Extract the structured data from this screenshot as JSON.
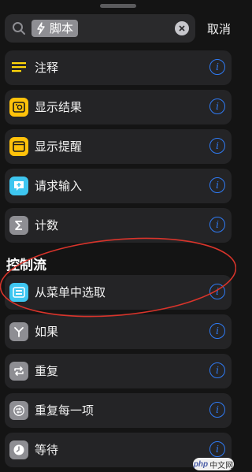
{
  "search": {
    "token_label": "脚本",
    "cancel_label": "取消"
  },
  "colors": {
    "background": "#141414",
    "row_bg": "#242426",
    "info_blue": "#2f7bf5",
    "annotation_red": "#d9342b"
  },
  "rows_top": [
    {
      "label": "注释",
      "icon": "comment-lines-icon",
      "icon_bg": "#242426",
      "icon_color": "#ffd60a"
    },
    {
      "label": "显示结果",
      "icon": "quick-look-icon",
      "icon_bg": "#ffc20a",
      "icon_color": "#1a1a1a"
    },
    {
      "label": "显示提醒",
      "icon": "alert-window-icon",
      "icon_bg": "#ffc20a",
      "icon_color": "#1a1a1a"
    },
    {
      "label": "请求输入",
      "icon": "ask-input-icon",
      "icon_bg": "#3ec6f0",
      "icon_color": "#ffffff"
    },
    {
      "label": "计数",
      "icon": "sigma-icon",
      "icon_bg": "#8e8e93",
      "icon_color": "#ffffff"
    }
  ],
  "section_title": "控制流",
  "rows_control": [
    {
      "label": "从菜单中选取",
      "icon": "menu-icon",
      "icon_bg": "#3ec6f0",
      "icon_color": "#ffffff"
    },
    {
      "label": "如果",
      "icon": "branch-icon",
      "icon_bg": "#8e8e93",
      "icon_color": "#ffffff"
    },
    {
      "label": "重复",
      "icon": "repeat-icon",
      "icon_bg": "#8e8e93",
      "icon_color": "#ffffff"
    },
    {
      "label": "重复每一项",
      "icon": "repeat-each-icon",
      "icon_bg": "#8e8e93",
      "icon_color": "#ffffff"
    },
    {
      "label": "等待",
      "icon": "clock-icon",
      "icon_bg": "#8e8e93",
      "icon_color": "#ffffff"
    }
  ],
  "info_glyph": "i",
  "watermark": {
    "brand": "php",
    "text": "中文网"
  }
}
